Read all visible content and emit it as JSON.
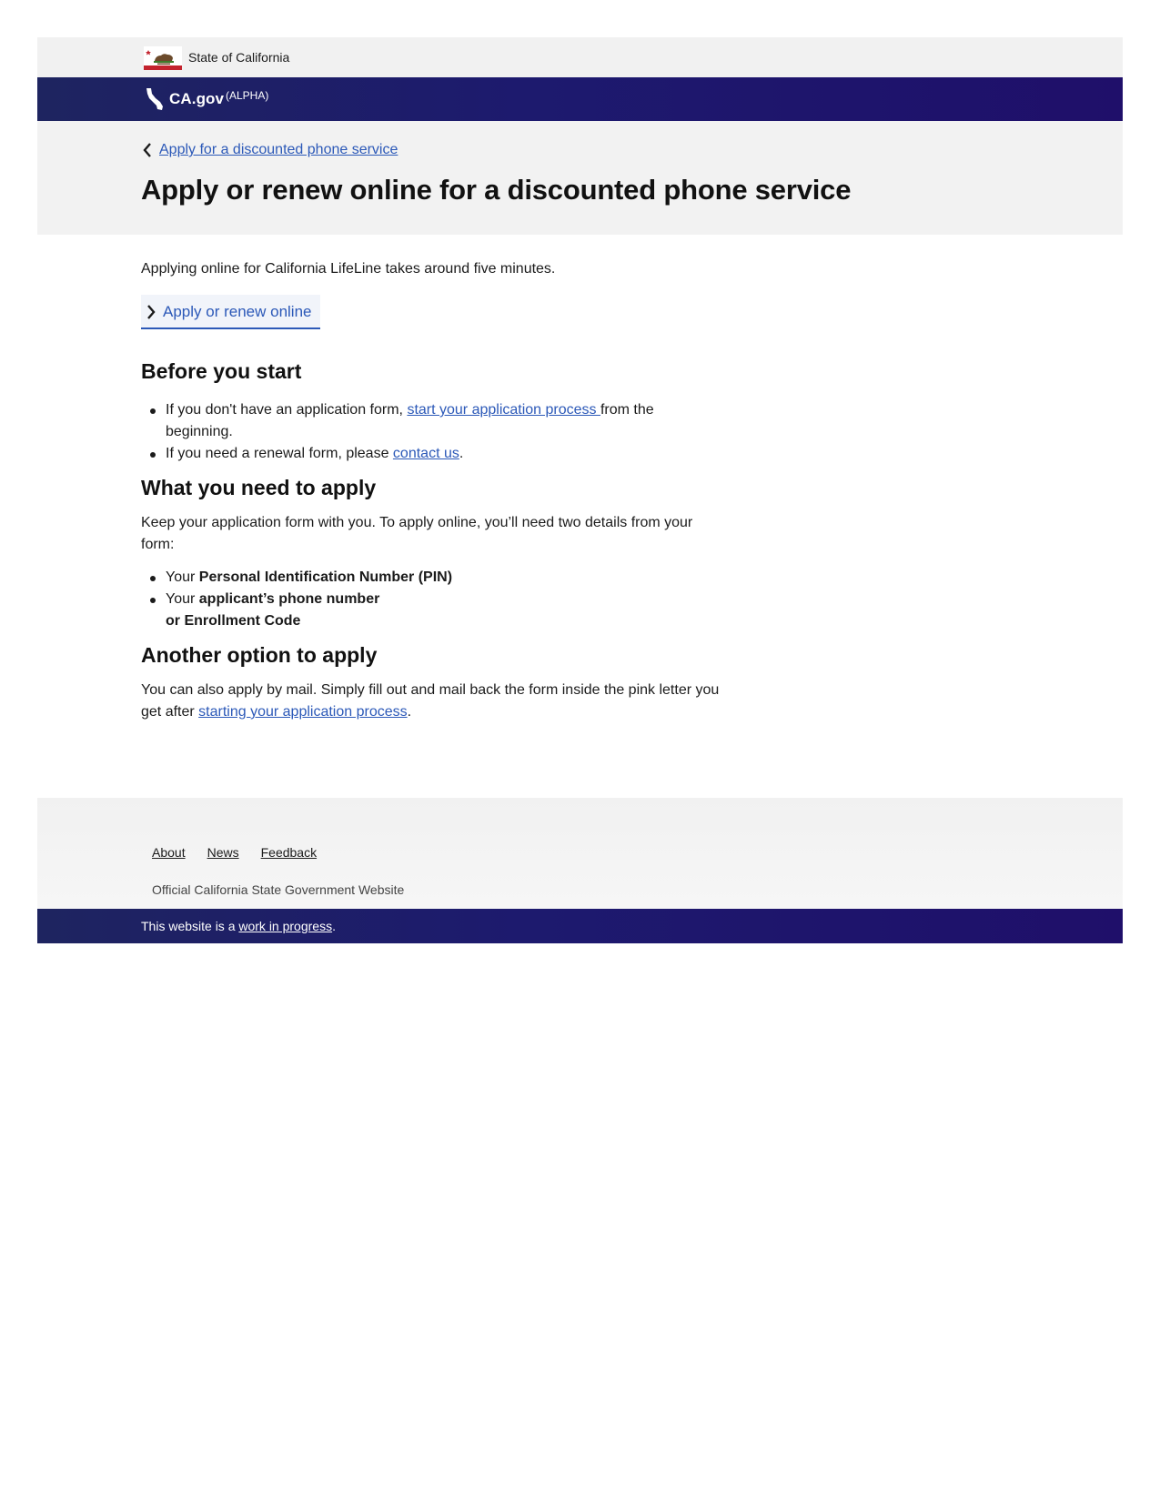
{
  "state_bar": {
    "label": "State of California",
    "flag_icon": "california-flag-icon"
  },
  "brand_bar": {
    "brand": "CA.gov",
    "badge": "(ALPHA)",
    "logo_icon": "california-outline-icon",
    "color": "#1d1a6e"
  },
  "hero": {
    "back_link": "Apply for a discounted phone service",
    "title": "Apply or renew online for a discounted phone service"
  },
  "main": {
    "intro": "Applying online for California LifeLine takes around five minutes.",
    "cta_label": "Apply or renew online",
    "before_heading": "Before you start",
    "before_items": [
      {
        "pre": "If you don't have an application form, ",
        "link": "start your application process ",
        "post": "from the beginning."
      },
      {
        "pre": "If you need a renewal form, please ",
        "link": "contact us",
        "post": "."
      }
    ],
    "need_heading": "What you need to apply",
    "need_text": "Keep your application form with you. To apply online, you’ll need two details from your form:",
    "need_items": [
      {
        "pre": "Your ",
        "bold": "Personal Identification Number (PIN)"
      },
      {
        "pre": "Your ",
        "bold": "applicant’s phone number",
        "bold2": "or Enrollment Code"
      }
    ],
    "other_heading": "Another option to apply",
    "other_pre": "You can also apply by mail. Simply fill out and mail back the form inside the pink letter you get after ",
    "other_link": "starting your application process",
    "other_post": "."
  },
  "footer": {
    "links": [
      "About",
      "News",
      "Feedback"
    ],
    "official": "Official California State Government Website",
    "wip_pre": "This website is a ",
    "wip_link": "work in progress",
    "wip_post": "."
  },
  "colors": {
    "link": "#2c59b8",
    "bar": "#1d1a6e",
    "panel": "#f2f2f2"
  }
}
